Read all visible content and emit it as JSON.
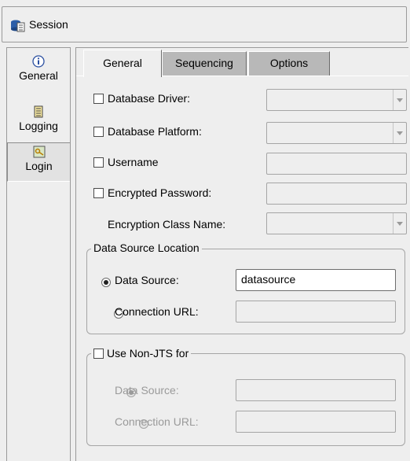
{
  "window": {
    "title": "Session",
    "icon": "session-icon"
  },
  "nav": {
    "items": [
      {
        "label": "General",
        "icon": "info-icon"
      },
      {
        "label": "Logging",
        "icon": "log-icon"
      },
      {
        "label": "Login",
        "icon": "login-key-icon",
        "selected": true
      }
    ]
  },
  "tabs": [
    {
      "label": "General",
      "active": true
    },
    {
      "label": "Sequencing"
    },
    {
      "label": "Options"
    }
  ],
  "general": {
    "database_driver_label": "Database Driver:",
    "database_platform_label": "Database Platform:",
    "username_label": "Username",
    "encrypted_password_label": "Encrypted Password:",
    "encryption_class_label": "Encryption Class Name:"
  },
  "data_source_location": {
    "title": "Data Source Location",
    "data_source_label": "Data Source:",
    "data_source_value": "datasource",
    "connection_url_label": "Connection URL:",
    "connection_url_value": ""
  },
  "non_jts": {
    "title": "Use Non-JTS for",
    "data_source_label": "Data Source:",
    "connection_url_label": "Connection URL:"
  }
}
